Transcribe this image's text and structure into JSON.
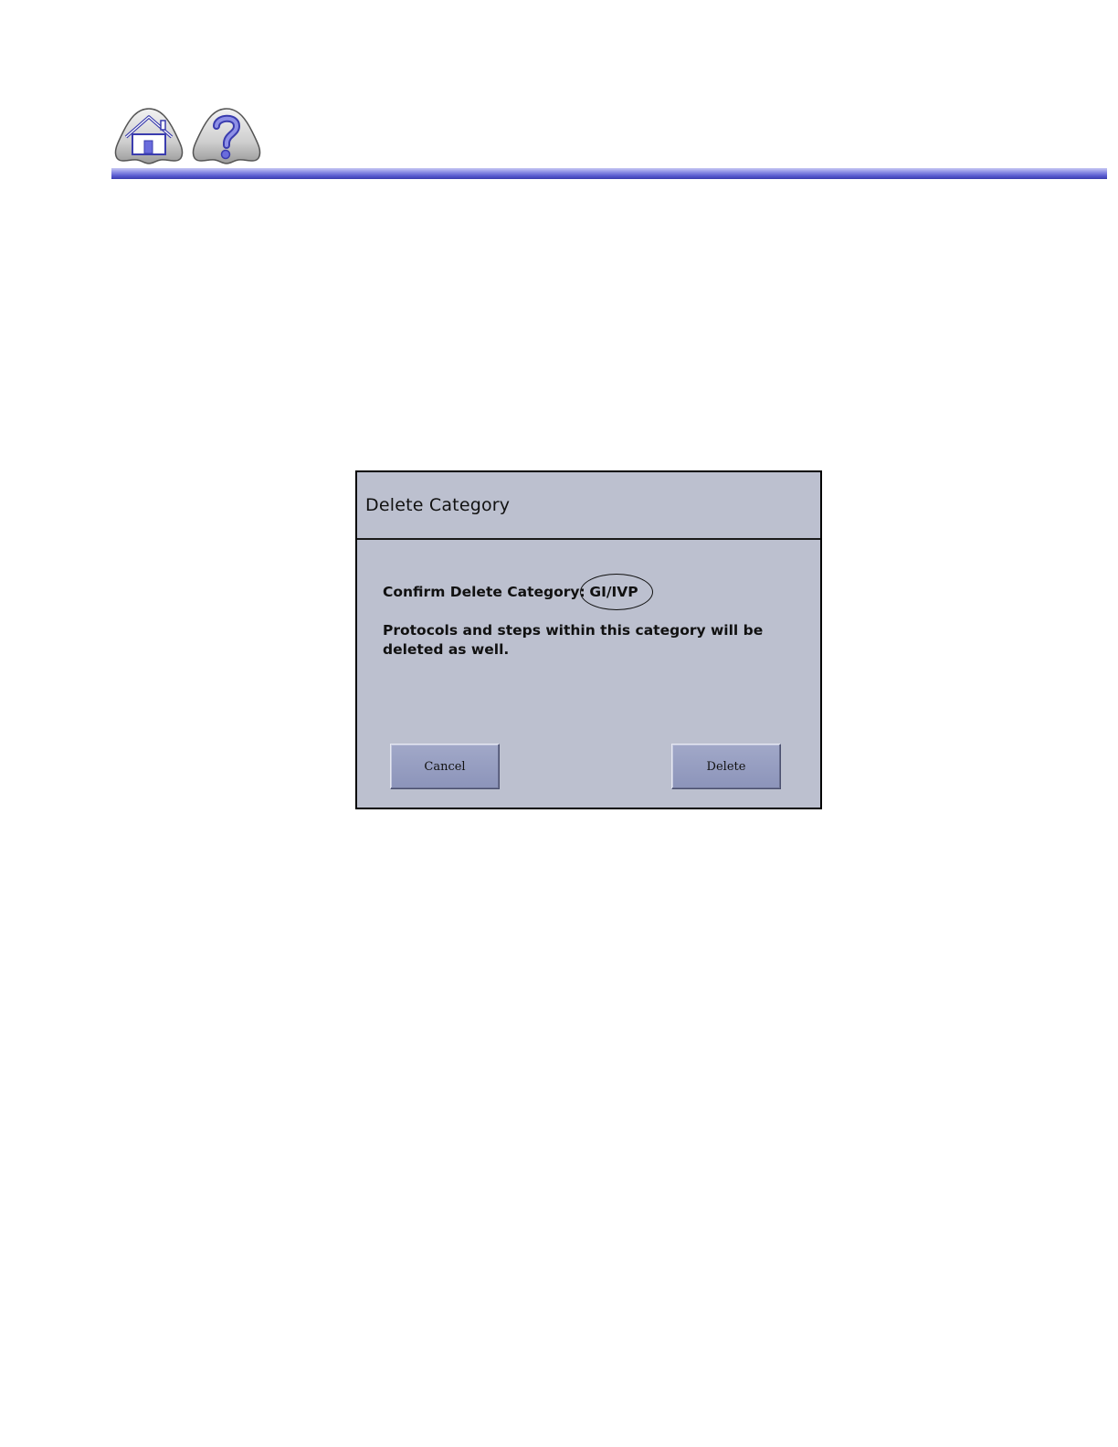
{
  "header": {
    "home_icon": "home-icon",
    "help_icon": "question-mark-icon",
    "rule_color": "#5a5cd0"
  },
  "dialog": {
    "title": "Delete Category",
    "confirm_label": "Confirm Delete Category:",
    "category_name": "GI/IVP",
    "warning_text": "Protocols and steps within this category will be deleted as well.",
    "cancel_label": "Cancel",
    "delete_label": "Delete",
    "background_color": "#bcc0cf",
    "button_color": "#8c94ba"
  }
}
